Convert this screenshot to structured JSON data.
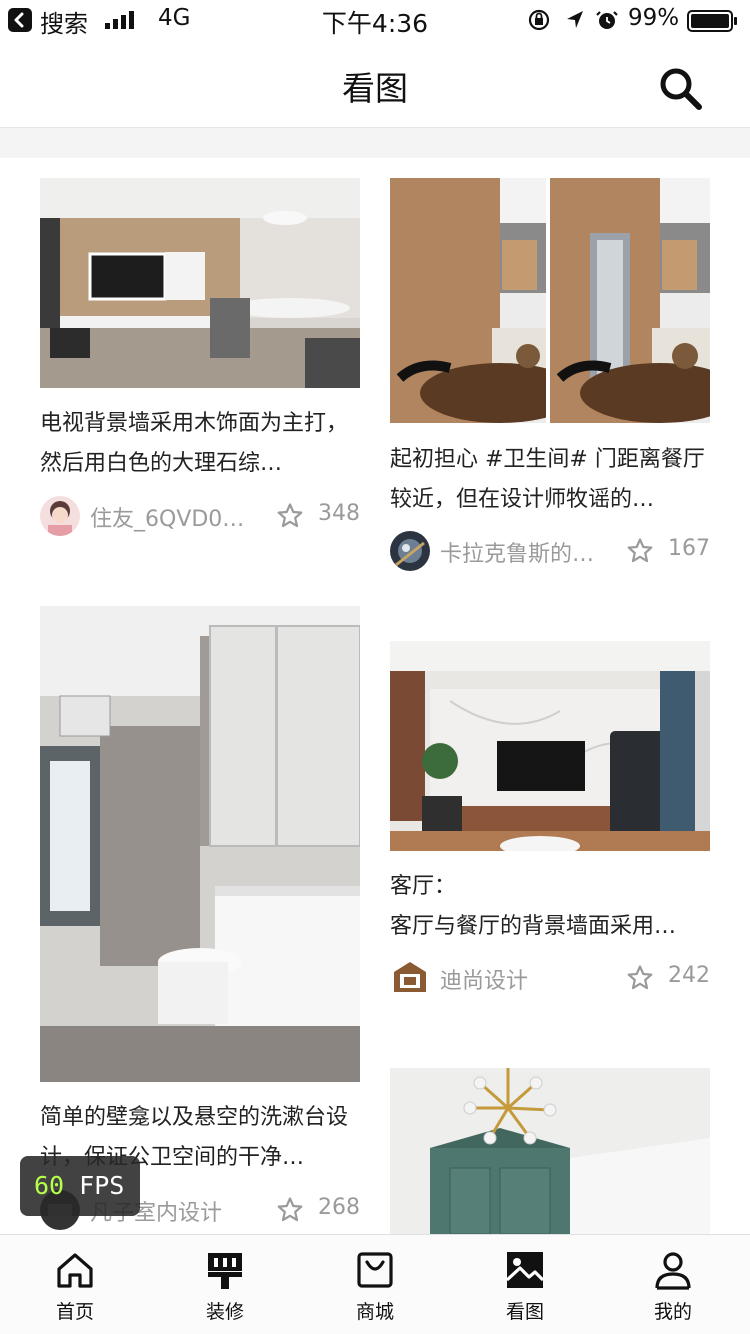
{
  "status_bar": {
    "carrier": "搜索",
    "network": "4G",
    "time": "下午4:36",
    "battery": "99%"
  },
  "nav": {
    "title": "看图"
  },
  "cards": [
    {
      "desc": "电视背景墙采用木饰面为主打，然后用白色的大理石综…",
      "author": "住友_6QVD0…",
      "likes": "348"
    },
    {
      "desc": "起初担心 #卫生间# 门距离餐厅较近，但在设计师牧谣的…",
      "author": "卡拉克鲁斯的…",
      "likes": "167"
    },
    {
      "desc": "简单的壁龛以及悬空的洗漱台设计，保证公卫空间的干净…",
      "author": "凡子室内设计",
      "likes": "268"
    },
    {
      "desc": "客厅：\n客厅与餐厅的背景墙面采用…",
      "author": "迪尚设计",
      "likes": "242"
    }
  ],
  "fps": {
    "value": "60",
    "unit": "FPS"
  },
  "tabbar": [
    {
      "label": "首页",
      "icon": "home-icon"
    },
    {
      "label": "装修",
      "icon": "brush-icon"
    },
    {
      "label": "商城",
      "icon": "shopping-bag-icon"
    },
    {
      "label": "看图",
      "icon": "picture-icon"
    },
    {
      "label": "我的",
      "icon": "user-icon"
    }
  ]
}
